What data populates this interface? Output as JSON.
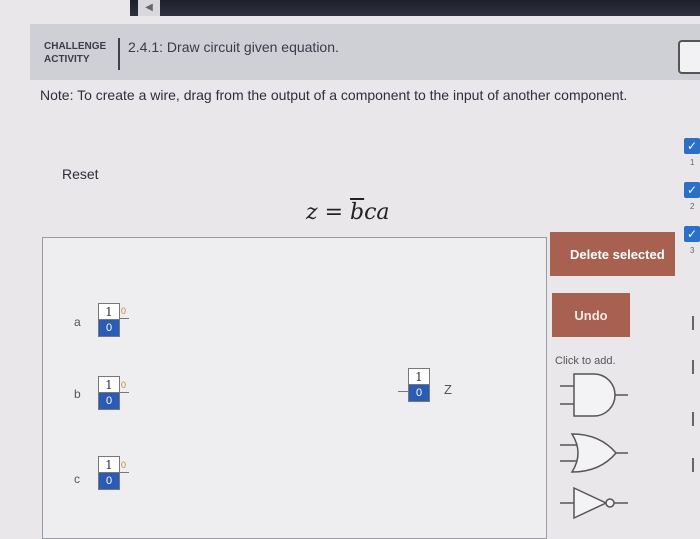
{
  "header": {
    "activity_line1": "CHALLENGE",
    "activity_line2": "ACTIVITY",
    "title": "2.4.1: Draw circuit given equation."
  },
  "note": "Note: To create a wire, drag from the output of a component to the input of another component.",
  "reset_label": "Reset",
  "equation": {
    "lhs": "z",
    "eq": " = ",
    "bar_var": "b",
    "rest": "ca"
  },
  "inputs": [
    {
      "label": "a",
      "on": "1",
      "off": "0",
      "value": "0"
    },
    {
      "label": "b",
      "on": "1",
      "off": "0",
      "value": "0"
    },
    {
      "label": "c",
      "on": "1",
      "off": "0",
      "value": "0"
    }
  ],
  "output": {
    "label": "z",
    "on": "1",
    "off": "0"
  },
  "buttons": {
    "delete": "Delete selected",
    "undo": "Undo"
  },
  "palette": {
    "title": "Click to add.",
    "gates": [
      "and-gate-icon",
      "or-gate-icon",
      "not-gate-icon"
    ]
  },
  "sidebar": {
    "checks": [
      "check-icon",
      "check-icon",
      "check-icon"
    ],
    "numbers": [
      "1",
      "2",
      "3"
    ]
  }
}
